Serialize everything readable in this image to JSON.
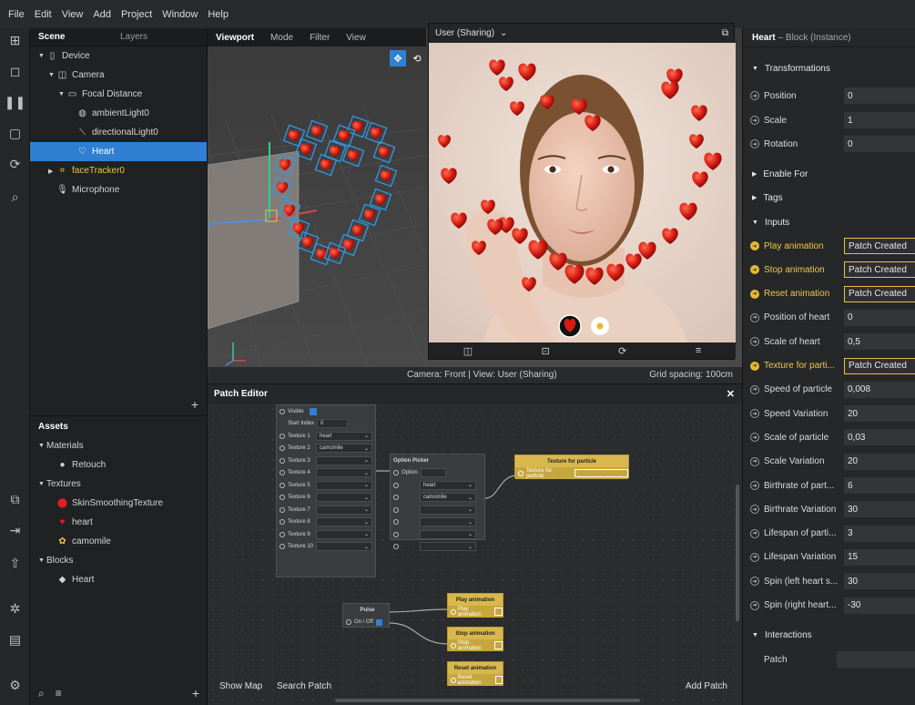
{
  "menu": [
    "File",
    "Edit",
    "View",
    "Add",
    "Project",
    "Window",
    "Help"
  ],
  "scene": {
    "tabs": [
      "Scene",
      "Layers"
    ],
    "tree": [
      {
        "label": "Device",
        "depth": 0,
        "arrow": "▼",
        "icon": "▯"
      },
      {
        "label": "Camera",
        "depth": 1,
        "arrow": "▼",
        "icon": "◫"
      },
      {
        "label": "Focal Distance",
        "depth": 2,
        "arrow": "▼",
        "icon": "▭"
      },
      {
        "label": "ambientLight0",
        "depth": 3,
        "arrow": "",
        "icon": "◍"
      },
      {
        "label": "directionalLight0",
        "depth": 3,
        "arrow": "",
        "icon": "⟍"
      },
      {
        "label": "Heart",
        "depth": 3,
        "arrow": "",
        "icon": "♡",
        "selected": true
      },
      {
        "label": "faceTracker0",
        "depth": 1,
        "arrow": "▶",
        "icon": "⌗",
        "yellow": true
      },
      {
        "label": "Microphone",
        "depth": 1,
        "arrow": "",
        "icon": "🎙"
      }
    ]
  },
  "assets": {
    "title": "Assets",
    "tree": [
      {
        "label": "Materials",
        "depth": 0,
        "arrow": "▼",
        "icon": ""
      },
      {
        "label": "Retouch",
        "depth": 1,
        "arrow": "",
        "icon": "●"
      },
      {
        "label": "Textures",
        "depth": 0,
        "arrow": "▼",
        "icon": ""
      },
      {
        "label": "SkinSmoothingTexture",
        "depth": 1,
        "arrow": "",
        "icon": "⬤"
      },
      {
        "label": "heart",
        "depth": 1,
        "arrow": "",
        "icon": "♥"
      },
      {
        "label": "camomile",
        "depth": 1,
        "arrow": "",
        "icon": "✿"
      },
      {
        "label": "Blocks",
        "depth": 0,
        "arrow": "▼",
        "icon": ""
      },
      {
        "label": "Heart",
        "depth": 1,
        "arrow": "",
        "icon": "◆"
      }
    ]
  },
  "viewport": {
    "tabs": [
      "Viewport",
      "Mode",
      "Filter",
      "View"
    ],
    "status": "Camera: Front | View: User (Sharing)",
    "grid": "Grid spacing: 100cm"
  },
  "preview": {
    "title": "User (Sharing)"
  },
  "patch": {
    "title": "Patch Editor",
    "show_map": "Show Map",
    "search_patch": "Search Patch",
    "add_patch": "Add Patch",
    "block": {
      "visible": "Visible",
      "start_index": "Start Index",
      "start_index_value": "0",
      "textures": [
        {
          "label": "Texture 1",
          "value": "heart"
        },
        {
          "label": "Texture 2",
          "value": "camomile"
        },
        {
          "label": "Texture 3",
          "value": ""
        },
        {
          "label": "Texture 4",
          "value": ""
        },
        {
          "label": "Texture 5",
          "value": ""
        },
        {
          "label": "Texture 6",
          "value": ""
        },
        {
          "label": "Texture 7",
          "value": ""
        },
        {
          "label": "Texture 8",
          "value": ""
        },
        {
          "label": "Texture 9",
          "value": ""
        },
        {
          "label": "Texture 10",
          "value": ""
        }
      ]
    },
    "option_picker": {
      "title": "Option Picker",
      "option": "Option",
      "items": [
        "heart",
        "camomile",
        "",
        "",
        "",
        ""
      ]
    },
    "texture_node": {
      "title": "Texture for particle",
      "port": "Texture for particle"
    },
    "pulse": {
      "title": "Pulse",
      "port": "On / Off"
    },
    "play": {
      "title": "Play animation",
      "port": "Play animation"
    },
    "stop": {
      "title": "Stop animation",
      "port": "Stop animation"
    },
    "reset": {
      "title": "Reset animation",
      "port": "Reset animation"
    }
  },
  "inspector": {
    "title": "Heart",
    "subtitle": "– Block (Instance)",
    "transformations": "Transformations",
    "position": {
      "label": "Position",
      "value": "0"
    },
    "scale": {
      "label": "Scale",
      "value": "1"
    },
    "rotation": {
      "label": "Rotation",
      "value": "0"
    },
    "enable_for": "Enable For",
    "tags": "Tags",
    "inputs_title": "Inputs",
    "inputs": [
      {
        "label": "Play animation",
        "value": "Patch Created",
        "patched": true
      },
      {
        "label": "Stop animation",
        "value": "Patch Created",
        "patched": true
      },
      {
        "label": "Reset animation",
        "value": "Patch Created",
        "patched": true
      },
      {
        "label": "Position of heart",
        "value": "0",
        "patched": false
      },
      {
        "label": "Scale of heart",
        "value": "0,5",
        "patched": false
      },
      {
        "label": "Texture for parti...",
        "value": "Patch Created",
        "patched": true
      },
      {
        "label": "Speed of particle",
        "value": "0,008",
        "patched": false
      },
      {
        "label": "Speed Variation",
        "value": "20",
        "patched": false
      },
      {
        "label": "Scale of particle",
        "value": "0,03",
        "patched": false
      },
      {
        "label": "Scale Variation",
        "value": "20",
        "patched": false
      },
      {
        "label": "Birthrate of part...",
        "value": "6",
        "patched": false
      },
      {
        "label": "Birthrate Variation",
        "value": "30",
        "patched": false
      },
      {
        "label": "Lifespan of parti...",
        "value": "3",
        "patched": false
      },
      {
        "label": "Lifespan Variation",
        "value": "15",
        "patched": false
      },
      {
        "label": "Spin (left heart s...",
        "value": "30",
        "patched": false
      },
      {
        "label": "Spin (right heart...",
        "value": "-30",
        "patched": false
      }
    ],
    "interactions": "Interactions",
    "patch_label": "Patch"
  },
  "colors": {
    "accent": "#2f80d2",
    "patch_yellow": "#d8b84c",
    "heart_red": "#d61c14"
  }
}
